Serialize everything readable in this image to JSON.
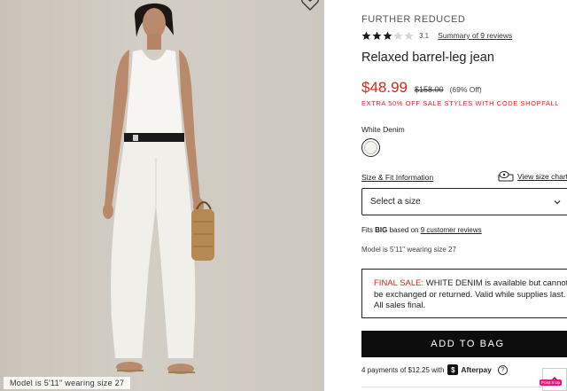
{
  "image": {
    "caption": "Model is 5'11\" wearing size 27"
  },
  "product": {
    "eyebrow": "FURTHER REDUCED",
    "rating": {
      "stars_filled": 3,
      "stars_total": 5,
      "value": "3.1",
      "reviews_link": "Summary of 9 reviews"
    },
    "name": "Relaxed barrel-leg jean",
    "price": {
      "sale": "$48.99",
      "original": "$158.00",
      "discount": "(69% Off)"
    },
    "promo": "EXTRA 50% OFF SALE STYLES WITH CODE SHOPFALL",
    "color_label": "White Denim",
    "size_fit_link": "Size & Fit Information",
    "size_chart_link": "View size chart",
    "size_select_placeholder": "Select a size",
    "fits": {
      "prefix": "Fits ",
      "emphasis": "BIG",
      "middle": " based on ",
      "link": "9 customer reviews"
    },
    "model_note": "Model is 5'11\" wearing size 27",
    "final_sale": {
      "label": "FINAL SALE:",
      "text": " WHITE DENIM is available but cannot be exchanged or returned. Valid while supplies last. All sales final."
    },
    "add_to_bag": "ADD TO BAG",
    "afterpay": {
      "text": "4 payments of $12.25 with",
      "badge": "$",
      "brand": "Afterpay",
      "info": "?"
    }
  },
  "floating": {
    "pin_badge": "Point It Up"
  },
  "colors": {
    "sale_red": "#d7261e",
    "button_black": "#0d0d0d",
    "background_photo": "#d0cbc2"
  }
}
